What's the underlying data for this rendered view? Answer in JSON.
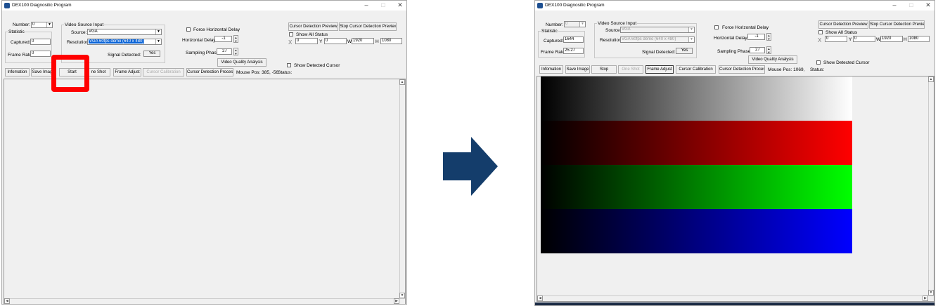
{
  "app": {
    "title": "DEX100 Diagnositic Program"
  },
  "labels": {
    "number": "Number:",
    "video_source_input": "Video Source Input",
    "statistic": "Statistic",
    "source": "Source:",
    "captured": "Captured:",
    "resolution": "Resolution:",
    "frame_rate": "Frame Rate:",
    "signal_detected": "Signal Detected:",
    "force_horizontal_delay": "Force Horizontal Delay",
    "horizontal_delay": "Horizontal Delay:",
    "sampling_phase": "Sampling Phase:",
    "show_all_status": "Show All Status",
    "show_detected_cursor": "Show Detected Cursor",
    "x": "X",
    "y": "Y",
    "w": "W",
    "h": "H",
    "status": "Status:"
  },
  "buttons": {
    "cursor_detection_preview": "Cursor Detection Preview",
    "stop_cursor_detection_preview": "Stop Cursor Detection Preview",
    "video_quality_analysis": "Video Quality Analysis",
    "information": "Infomation",
    "save_image": "Save Image",
    "frame_adjust": "Frame Adjust",
    "cursor_calibration": "Cursor Calibration",
    "cursor_detection_process": "Cursor Detection Process",
    "one_shot": "One Shot"
  },
  "before": {
    "number": "0",
    "source": "VGA",
    "resolution": "VGA 60fps demo (640 x 480)",
    "captured": "0",
    "frame_rate": "0",
    "signal": "Yes",
    "horizontal_delay": "-1",
    "sampling_phase": "27",
    "x": "0",
    "y": "0",
    "w": "1920",
    "h": "1080",
    "mouse_pos": "Mouse Pos: 385, -56",
    "start_stop": "Start",
    "save_image_label": "Save Imag",
    "one_shot_label": "ne Shot"
  },
  "after": {
    "number": "0",
    "source": "VGA",
    "resolution": "VGA 60fps demo (640 x 480)",
    "captured": "1644",
    "frame_rate": "25.27",
    "signal": "Yes",
    "horizontal_delay": "-1",
    "sampling_phase": "27",
    "x": "0",
    "y": "0",
    "w": "1920",
    "h": "1080",
    "mouse_pos": "Mouse Pos: 1069,",
    "start_stop": "Stop"
  },
  "colors": {
    "highlight": "#ff0000",
    "arrow": "#143d6b",
    "selection": "#0a64d8"
  },
  "test_pattern": [
    "white",
    "red",
    "green",
    "blue"
  ]
}
